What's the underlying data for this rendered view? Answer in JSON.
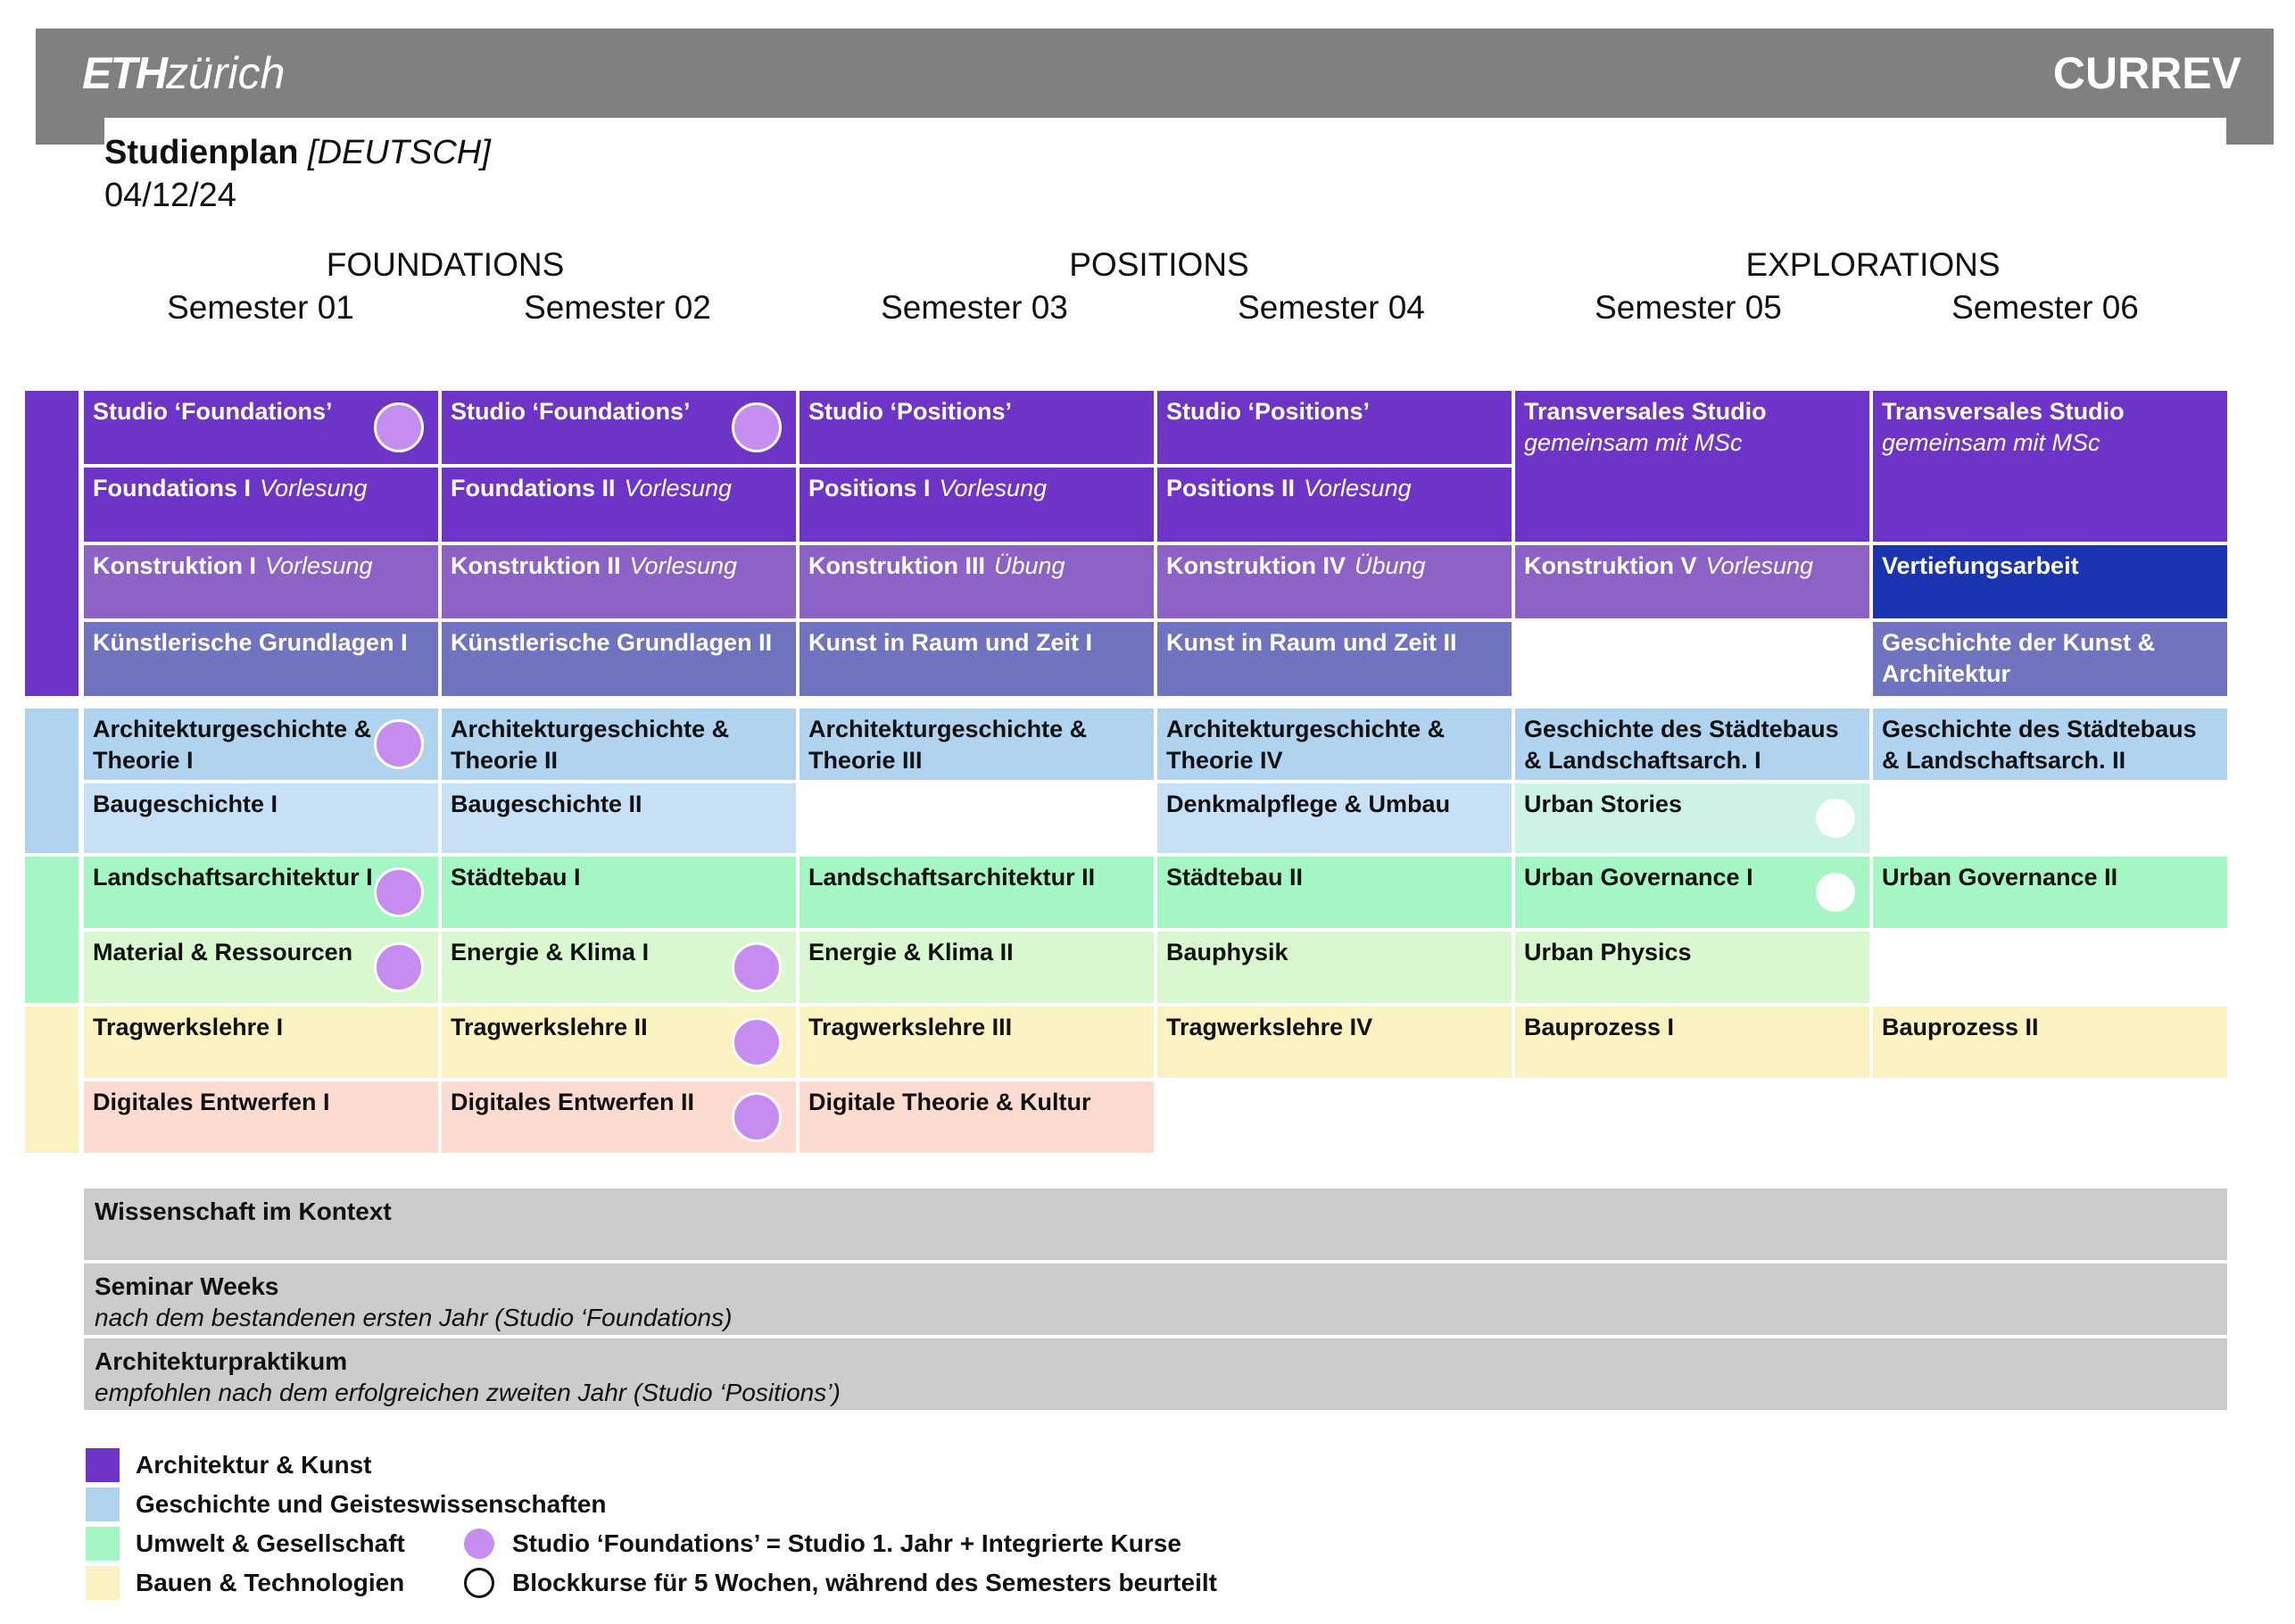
{
  "header": {
    "logo_eth": "ETH",
    "logo_zurich": "zürich",
    "brand": "CURREV",
    "title_bold": "Studienplan",
    "title_lang": "[DEUTSCH]",
    "date": "04/12/24"
  },
  "phases": [
    "FOUNDATIONS",
    "POSITIONS",
    "EXPLORATIONS"
  ],
  "semesters": [
    "Semester 01",
    "Semester 02",
    "Semester 03",
    "Semester 04",
    "Semester 05",
    "Semester 06"
  ],
  "colors": {
    "architektur_kunst": "#6e34c8",
    "architektur_kunst_mid": "#8c62c6",
    "architektur_kunst_light": "#6f73c0",
    "vertiefung": "#1a33b0",
    "geschichte": "#b0d4f0",
    "geschichte_light": "#c8e0f5",
    "umwelt": "#a4f7c4",
    "umwelt_light": "#d9f8cf",
    "urban_stories": "#cdf2e8",
    "bauen": "#fbf2c2",
    "digital": "#fddbd1",
    "context_bar": "#cccccc",
    "dot": "#c68cf0"
  },
  "cells": [
    {
      "col": 0,
      "row": 0,
      "span": 1,
      "title": "Studio ‘Foundations’",
      "sub": "",
      "fill": "architektur_kunst",
      "white": true,
      "dot": "filled"
    },
    {
      "col": 1,
      "row": 0,
      "span": 1,
      "title": "Studio ‘Foundations’",
      "sub": "",
      "fill": "architektur_kunst",
      "white": true,
      "dot": "filled"
    },
    {
      "col": 2,
      "row": 0,
      "span": 1,
      "title": "Studio ‘Positions’",
      "sub": "",
      "fill": "architektur_kunst",
      "white": true
    },
    {
      "col": 3,
      "row": 0,
      "span": 1,
      "title": "Studio ‘Positions’",
      "sub": "",
      "fill": "architektur_kunst",
      "white": true
    },
    {
      "col": 4,
      "row": 0,
      "span": 2,
      "title": "Transversales Studio",
      "sub2": "gemeinsam mit MSc",
      "fill": "architektur_kunst",
      "white": true
    },
    {
      "col": 5,
      "row": 0,
      "span": 2,
      "title": "Transversales Studio",
      "sub2": "gemeinsam mit MSc",
      "fill": "architektur_kunst",
      "white": true
    },
    {
      "col": 0,
      "row": 1,
      "span": 1,
      "title": "Foundations I",
      "sub": "Vorlesung",
      "fill": "architektur_kunst",
      "white": true
    },
    {
      "col": 1,
      "row": 1,
      "span": 1,
      "title": "Foundations II",
      "sub": "Vorlesung",
      "fill": "architektur_kunst",
      "white": true
    },
    {
      "col": 2,
      "row": 1,
      "span": 1,
      "title": "Positions I",
      "sub": "Vorlesung",
      "fill": "architektur_kunst",
      "white": true
    },
    {
      "col": 3,
      "row": 1,
      "span": 1,
      "title": "Positions II",
      "sub": "Vorlesung",
      "fill": "architektur_kunst",
      "white": true
    },
    {
      "col": 0,
      "row": 2,
      "span": 1,
      "title": "Konstruktion I",
      "sub": "Vorlesung",
      "fill": "architektur_kunst_mid",
      "white": true
    },
    {
      "col": 1,
      "row": 2,
      "span": 1,
      "title": "Konstruktion II",
      "sub": "Vorlesung",
      "fill": "architektur_kunst_mid",
      "white": true
    },
    {
      "col": 2,
      "row": 2,
      "span": 1,
      "title": "Konstruktion III",
      "sub": "Übung",
      "fill": "architektur_kunst_mid",
      "white": true
    },
    {
      "col": 3,
      "row": 2,
      "span": 1,
      "title": "Konstruktion IV",
      "sub": "Übung",
      "fill": "architektur_kunst_mid",
      "white": true
    },
    {
      "col": 4,
      "row": 2,
      "span": 1,
      "title": "Konstruktion V",
      "sub": "Vorlesung",
      "fill": "architektur_kunst_mid",
      "white": true
    },
    {
      "col": 5,
      "row": 2,
      "span": 1,
      "title": "Vertiefungsarbeit",
      "sub": "",
      "fill": "vertiefung",
      "white": true
    },
    {
      "col": 0,
      "row": 3,
      "span": 1,
      "title": "Künstlerische Grundlagen I",
      "sub": "",
      "fill": "architektur_kunst_light",
      "white": true
    },
    {
      "col": 1,
      "row": 3,
      "span": 1,
      "title": "Künstlerische Grundlagen II",
      "sub": "",
      "fill": "architektur_kunst_light",
      "white": true
    },
    {
      "col": 2,
      "row": 3,
      "span": 1,
      "title": "Kunst in Raum und Zeit I",
      "sub": "",
      "fill": "architektur_kunst_light",
      "white": true
    },
    {
      "col": 3,
      "row": 3,
      "span": 1,
      "title": "Kunst in Raum und Zeit II",
      "sub": "",
      "fill": "architektur_kunst_light",
      "white": true
    },
    {
      "col": 5,
      "row": 3,
      "span": 1,
      "title": "Geschichte der Kunst & Architektur",
      "sub": "",
      "fill": "architektur_kunst_light",
      "white": true
    },
    {
      "col": 0,
      "row": 4,
      "span": 1,
      "title": "Architekturgeschichte & Theorie I",
      "sub": "",
      "fill": "geschichte",
      "dot": "filled"
    },
    {
      "col": 1,
      "row": 4,
      "span": 1,
      "title": "Architekturgeschichte & Theorie II",
      "sub": "",
      "fill": "geschichte"
    },
    {
      "col": 2,
      "row": 4,
      "span": 1,
      "title": "Architekturgeschichte & Theorie III",
      "sub": "",
      "fill": "geschichte"
    },
    {
      "col": 3,
      "row": 4,
      "span": 1,
      "title": "Architekturgeschichte & Theorie IV",
      "sub": "",
      "fill": "geschichte"
    },
    {
      "col": 4,
      "row": 4,
      "span": 1,
      "title": "Geschichte des Städtebaus & Landschaftsarch. I",
      "sub": "",
      "fill": "geschichte"
    },
    {
      "col": 5,
      "row": 4,
      "span": 1,
      "title": "Geschichte des Städtebaus & Landschaftsarch. II",
      "sub": "",
      "fill": "geschichte"
    },
    {
      "col": 0,
      "row": 5,
      "span": 1,
      "title": "Baugeschichte I",
      "sub": "",
      "fill": "geschichte_light"
    },
    {
      "col": 1,
      "row": 5,
      "span": 1,
      "title": "Baugeschichte II",
      "sub": "",
      "fill": "geschichte_light"
    },
    {
      "col": 3,
      "row": 5,
      "span": 1,
      "title": "Denkmalpflege & Umbau",
      "sub": "",
      "fill": "geschichte_light"
    },
    {
      "col": 4,
      "row": 5,
      "span": 1,
      "title": "Urban Stories",
      "sub": "",
      "fill": "urban_stories",
      "dot": "open"
    },
    {
      "col": 0,
      "row": 6,
      "span": 1,
      "title": "Landschaftsarchitektur I",
      "sub": "",
      "fill": "umwelt",
      "dot": "filled"
    },
    {
      "col": 1,
      "row": 6,
      "span": 1,
      "title": "Städtebau I",
      "sub": "",
      "fill": "umwelt"
    },
    {
      "col": 2,
      "row": 6,
      "span": 1,
      "title": "Landschaftsarchitektur II",
      "sub": "",
      "fill": "umwelt"
    },
    {
      "col": 3,
      "row": 6,
      "span": 1,
      "title": "Städtebau II",
      "sub": "",
      "fill": "umwelt"
    },
    {
      "col": 4,
      "row": 6,
      "span": 1,
      "title": "Urban Governance I",
      "sub": "",
      "fill": "umwelt",
      "dot": "open"
    },
    {
      "col": 5,
      "row": 6,
      "span": 1,
      "title": "Urban Governance II",
      "sub": "",
      "fill": "umwelt"
    },
    {
      "col": 0,
      "row": 7,
      "span": 1,
      "title": "Material & Ressourcen",
      "sub": "",
      "fill": "umwelt_light",
      "dot": "filled"
    },
    {
      "col": 1,
      "row": 7,
      "span": 1,
      "title": "Energie & Klima I",
      "sub": "",
      "fill": "umwelt_light",
      "dot": "filled"
    },
    {
      "col": 2,
      "row": 7,
      "span": 1,
      "title": "Energie & Klima II",
      "sub": "",
      "fill": "umwelt_light"
    },
    {
      "col": 3,
      "row": 7,
      "span": 1,
      "title": "Bauphysik",
      "sub": "",
      "fill": "umwelt_light"
    },
    {
      "col": 4,
      "row": 7,
      "span": 1,
      "title": "Urban Physics",
      "sub": "",
      "fill": "umwelt_light"
    },
    {
      "col": 0,
      "row": 8,
      "span": 1,
      "title": "Tragwerkslehre I",
      "sub": "",
      "fill": "bauen"
    },
    {
      "col": 1,
      "row": 8,
      "span": 1,
      "title": "Tragwerkslehre II",
      "sub": "",
      "fill": "bauen",
      "dot": "filled"
    },
    {
      "col": 2,
      "row": 8,
      "span": 1,
      "title": "Tragwerkslehre III",
      "sub": "",
      "fill": "bauen"
    },
    {
      "col": 3,
      "row": 8,
      "span": 1,
      "title": "Tragwerkslehre IV",
      "sub": "",
      "fill": "bauen"
    },
    {
      "col": 4,
      "row": 8,
      "span": 1,
      "title": "Bauprozess I",
      "sub": "",
      "fill": "bauen"
    },
    {
      "col": 5,
      "row": 8,
      "span": 1,
      "title": "Bauprozess II",
      "sub": "",
      "fill": "bauen"
    },
    {
      "col": 0,
      "row": 9,
      "span": 1,
      "title": "Digitales Entwerfen I",
      "sub": "",
      "fill": "digital"
    },
    {
      "col": 1,
      "row": 9,
      "span": 1,
      "title": "Digitales Entwerfen II",
      "sub": "",
      "fill": "digital",
      "dot": "filled"
    },
    {
      "col": 2,
      "row": 9,
      "span": 1,
      "title": "Digitale Theorie & Kultur",
      "sub": "",
      "fill": "digital"
    }
  ],
  "context_bars": [
    {
      "title": "Wissenschaft im Kontext",
      "sub": ""
    },
    {
      "title": "Seminar Weeks",
      "sub": "nach dem bestandenen ersten Jahr (Studio ‘Foundations)"
    },
    {
      "title": "Architekturpraktikum",
      "sub": "empfohlen nach dem erfolgreichen zweiten Jahr (Studio ‘Positions’)"
    }
  ],
  "legend": {
    "categories": [
      {
        "label": "Architektur & Kunst",
        "color": "#6e34c8"
      },
      {
        "label": "Geschichte und Geisteswissenschaften",
        "color": "#b0d4f0"
      },
      {
        "label": "Umwelt & Gesellschaft",
        "color": "#a4f7c4"
      },
      {
        "label": "Bauen & Technologien",
        "color": "#fbf2c2"
      }
    ],
    "markers": [
      {
        "label": "Studio ‘Foundations’ = Studio 1. Jahr + Integrierte Kurse",
        "style": "filled"
      },
      {
        "label": "Blockkurse für 5 Wochen, während des Semesters beurteilt",
        "style": "open"
      }
    ]
  }
}
